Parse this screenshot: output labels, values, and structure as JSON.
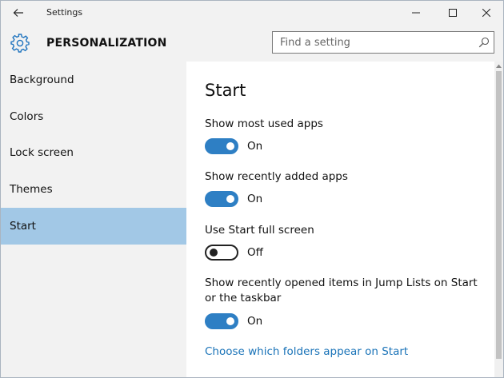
{
  "window": {
    "title": "Settings"
  },
  "header": {
    "section_title": "PERSONALIZATION",
    "search_placeholder": "Find a setting"
  },
  "sidebar": {
    "items": [
      {
        "label": "Background",
        "active": false
      },
      {
        "label": "Colors",
        "active": false
      },
      {
        "label": "Lock screen",
        "active": false
      },
      {
        "label": "Themes",
        "active": false
      },
      {
        "label": "Start",
        "active": true
      }
    ]
  },
  "content": {
    "heading": "Start",
    "settings": [
      {
        "label": "Show most used apps",
        "state": "On",
        "on": true
      },
      {
        "label": "Show recently added apps",
        "state": "On",
        "on": true
      },
      {
        "label": "Use Start full screen",
        "state": "Off",
        "on": false
      },
      {
        "label": "Show recently opened items in Jump Lists on Start or the taskbar",
        "state": "On",
        "on": true
      }
    ],
    "link": "Choose which folders appear on Start"
  },
  "icons": {
    "back": "back-arrow-icon",
    "minimize": "minimize-icon",
    "maximize": "maximize-icon",
    "close": "close-icon",
    "gear": "gear-icon",
    "search": "search-icon"
  },
  "colors": {
    "accent": "#2e7fc4",
    "active_nav": "#a2c8e6",
    "link": "#1a73b8",
    "chrome": "#f2f2f2"
  }
}
